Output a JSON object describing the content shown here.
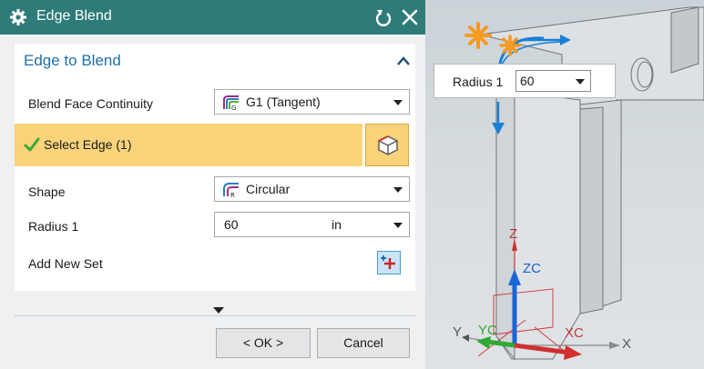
{
  "dialog": {
    "title": "Edge Blend",
    "icons": {
      "settings": "gear-icon",
      "reset": "reset-icon",
      "close": "close-icon"
    }
  },
  "group": {
    "heading": "Edge to Blend",
    "continuity": {
      "label": "Blend Face Continuity",
      "value": "G1 (Tangent)"
    },
    "select_edge": {
      "label": "Select Edge (1)"
    },
    "shape": {
      "label": "Shape",
      "value": "Circular"
    },
    "radius": {
      "label": "Radius 1",
      "value": "60",
      "unit": "in"
    },
    "add_set": {
      "label": "Add New Set"
    }
  },
  "buttons": {
    "ok": "< OK >",
    "cancel": "Cancel"
  },
  "viewport": {
    "radius_popup": {
      "label": "Radius 1",
      "value": "60"
    },
    "axes": {
      "z": "Z",
      "zc": "ZC",
      "y": "Y",
      "yc": "YC",
      "xc": "XC",
      "x": "X"
    }
  },
  "colors": {
    "titlebar": "#2e7b7a",
    "heading": "#1e6fa8",
    "selection_highlight": "#f8d37a",
    "handle_orange": "#f59a23",
    "handle_blue": "#1a7fd6"
  }
}
